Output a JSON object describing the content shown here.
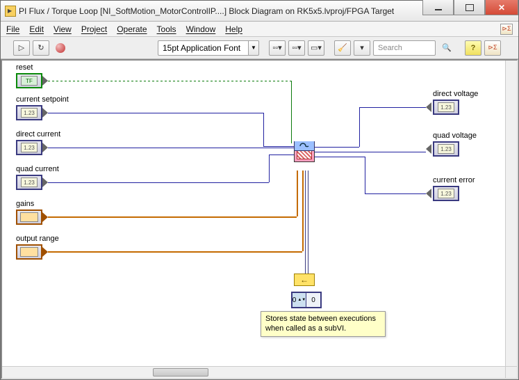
{
  "window": {
    "title": "PI Flux / Torque Loop [NI_SoftMotion_MotorControlIP....] Block Diagram on RK5x5.lvproj/FPGA Target"
  },
  "menus": {
    "file": "File",
    "edit": "Edit",
    "view": "View",
    "project": "Project",
    "operate": "Operate",
    "tools": "Tools",
    "window": "Window",
    "help": "Help"
  },
  "toolbar": {
    "font": "15pt Application Font",
    "search_placeholder": "Search",
    "help_q": "?"
  },
  "inputs": {
    "reset": "reset",
    "current_setpoint": "current setpoint",
    "direct_current": "direct current",
    "quad_current": "quad current",
    "gains": "gains",
    "output_range": "output range"
  },
  "outputs": {
    "direct_voltage": "direct voltage",
    "quad_voltage": "quad voltage",
    "current_error": "current error"
  },
  "node_num_inner": "1.23",
  "array": {
    "index": "0",
    "elem": "0"
  },
  "tooltip": "Stores state between executions when called as a subVI."
}
